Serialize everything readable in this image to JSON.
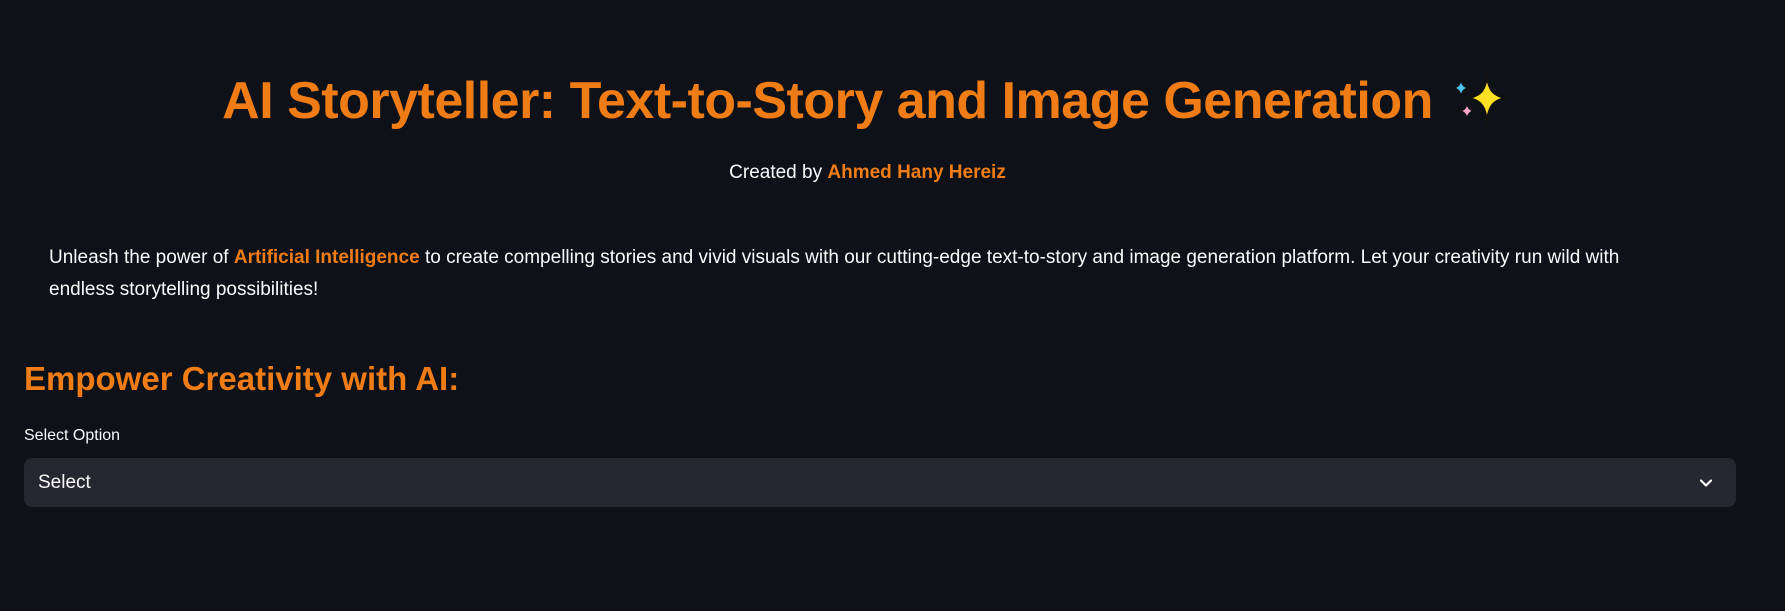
{
  "header": {
    "title": "AI Storyteller: Text-to-Story and Image Generation",
    "title_icon": "sparkles-icon",
    "credit_prefix": "Created by ",
    "credit_author": "Ahmed Hany Hereiz"
  },
  "intro": {
    "text_before": "Unleash the power of ",
    "highlight": "Artificial Intelligence",
    "text_after": " to create compelling stories and vivid visuals with our cutting-edge text-to-story and image generation platform. Let your creativity run wild with endless storytelling possibilities!"
  },
  "main": {
    "section_heading": "Empower Creativity with AI:",
    "select": {
      "label": "Select Option",
      "value": "Select",
      "icon": "chevron-down-icon"
    }
  },
  "colors": {
    "background": "#0e1117",
    "accent": "#f07c16",
    "text": "#fafafa",
    "input_background": "#262730"
  }
}
